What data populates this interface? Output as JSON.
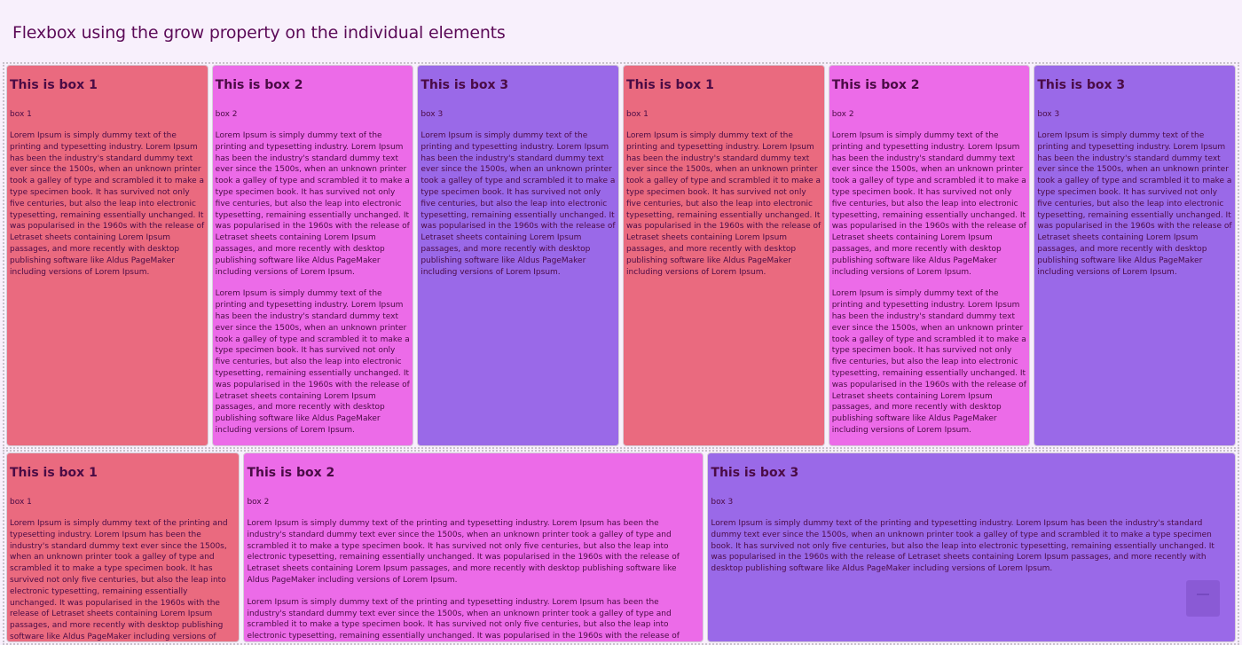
{
  "page": {
    "title": "Flexbox using the grow property on the individual elements"
  },
  "colors": {
    "background": "#f8f0fc",
    "box1": "#ea6a7f",
    "box2": "#ec6be8",
    "box3": "#9a69e8",
    "text": "#4a0b45"
  },
  "boxes": {
    "box1": {
      "title": "This is box 1",
      "sub": "box 1"
    },
    "box2": {
      "title": "This is box 2",
      "sub": "box 2"
    },
    "box3": {
      "title": "This is box 3",
      "sub": "box 3"
    }
  },
  "lorem": "Lorem Ipsum is simply dummy text of the printing and typesetting industry. Lorem Ipsum has been the industry's standard dummy text ever since the 1500s, when an unknown printer took a galley of type and scrambled it to make a type specimen book. It has survived not only five centuries, but also the leap into electronic typesetting, remaining essentially unchanged. It was popularised in the 1960s with the release of Letraset sheets containing Lorem Ipsum passages, and more recently with desktop publishing software like Aldus PageMaker including versions of Lorem Ipsum.",
  "scroll_top": {
    "icon": "arrow-up-icon"
  }
}
